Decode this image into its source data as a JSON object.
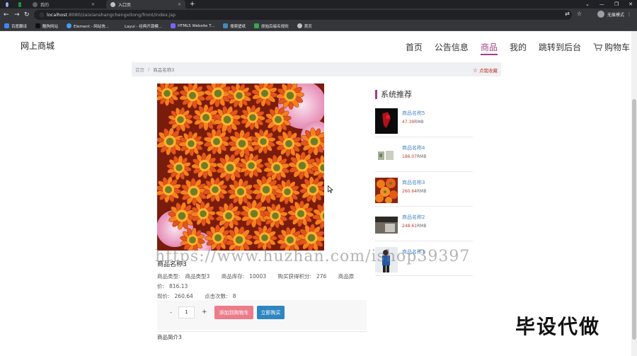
{
  "browser": {
    "tabs": [
      {
        "label": ""
      },
      {
        "label": ""
      },
      {
        "label": "我的"
      },
      {
        "label": "入口页"
      }
    ],
    "url_host": "localhost",
    "url_path": ":8080/zaixianshangchengxitong/front/index.jsp",
    "profile_label": "无痕模式",
    "bookmarks": [
      {
        "label": "百度翻译"
      },
      {
        "label": "酷狗网站"
      },
      {
        "label": "Element - 网站快..."
      },
      {
        "label": "Layui - 经典开源模..."
      },
      {
        "label": "HTML5 Website T..."
      },
      {
        "label": "搜索壁纸"
      },
      {
        "label": "原始后缀名规则"
      },
      {
        "label": "首页"
      }
    ]
  },
  "site": {
    "logo": "网上商城",
    "nav": [
      {
        "label": "首页"
      },
      {
        "label": "公告信息"
      },
      {
        "label": "商品"
      },
      {
        "label": "我的"
      },
      {
        "label": "跳转到后台"
      },
      {
        "label": "购物车"
      }
    ],
    "breadcrumb": {
      "home": "首页",
      "sep": "/",
      "current": "商品名称3"
    },
    "favorite_label": "点我收藏"
  },
  "product": {
    "name": "商品名称3",
    "type_label": "商品类型:",
    "type_value": "商品类型3",
    "stock_label": "商品库存:",
    "stock_value": "10003",
    "points_label": "购买获得积分:",
    "points_value": "276",
    "orig_price_label": "商品原价:",
    "orig_price_value": "816.13",
    "price_label": "现价:",
    "price_value": "260.64",
    "clicks_label": "点击次数:",
    "clicks_value": "8",
    "quantity": "1",
    "minus_label": "-",
    "plus_label": "+",
    "add_to_cart_label": "添加到购物车",
    "buy_now_label": "立即购买",
    "intro": "商品简介3"
  },
  "recommend": {
    "title": "系统推荐",
    "items": [
      {
        "name": "商品名称5",
        "price": "47.39",
        "unit": "RMB"
      },
      {
        "name": "商品名称4",
        "price": "186.07",
        "unit": "RMB"
      },
      {
        "name": "商品名称3",
        "price": "260.64",
        "unit": "RMB"
      },
      {
        "name": "商品名称2",
        "price": "248.61",
        "unit": "RMB"
      },
      {
        "name": "商品名称1",
        "price": "",
        "unit": ""
      }
    ]
  },
  "overlays": {
    "watermark": "https://www.huzhan.com/ishop39397",
    "stamp": "毕设代做"
  },
  "colors": {
    "accent": "#9c3f88",
    "price_red": "#c0392b",
    "link_blue": "#4a86c5",
    "cart_button": "#ee7b89",
    "buy_button": "#2e86c1"
  }
}
